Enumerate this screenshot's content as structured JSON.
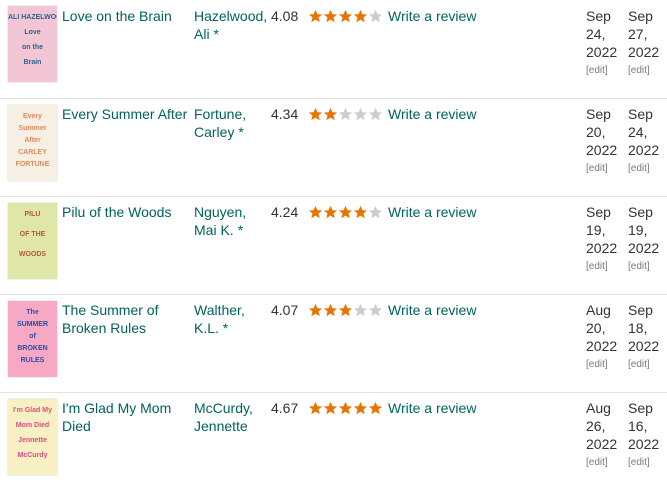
{
  "colors": {
    "link": "#00635d",
    "star_filled": "#e87400",
    "star_empty": "#cccccc"
  },
  "books": [
    {
      "title": "Love on the Brain",
      "author": "Hazelwood, Ali *",
      "avg_rating": "4.08",
      "stars": 4,
      "review_label": "Write a review",
      "date_a": [
        "Sep",
        "24,",
        "2022"
      ],
      "date_b": [
        "Sep",
        "27,",
        "2022"
      ],
      "edit_a": "[edit]",
      "edit_b": "[edit]",
      "cover": {
        "bg": "#f3c6d6",
        "accent": "#2f5f8f",
        "lines": [
          "ALI HAZELWOOD",
          "Love",
          "on the",
          "Brain"
        ]
      }
    },
    {
      "title": "Every Summer After",
      "author": "Fortune, Carley *",
      "avg_rating": "4.34",
      "stars": 2,
      "review_label": "Write a review",
      "date_a": [
        "Sep",
        "20,",
        "2022"
      ],
      "date_b": [
        "Sep",
        "24,",
        "2022"
      ],
      "edit_a": "[edit]",
      "edit_b": "[edit]",
      "cover": {
        "bg": "#f6efe4",
        "accent": "#e08a5a",
        "lines": [
          "Every",
          "Summer",
          "After",
          "CARLEY",
          "FORTUNE"
        ]
      }
    },
    {
      "title": "Pilu of the Woods",
      "author": "Nguyen, Mai K. *",
      "avg_rating": "4.24",
      "stars": 4,
      "review_label": "Write a review",
      "date_a": [
        "Sep",
        "19,",
        "2022"
      ],
      "date_b": [
        "Sep",
        "19,",
        "2022"
      ],
      "edit_a": "[edit]",
      "edit_b": "[edit]",
      "cover": {
        "bg": "#dfe6a8",
        "accent": "#b45a3a",
        "lines": [
          "PILU",
          "OF THE",
          "WOODS"
        ]
      }
    },
    {
      "title": "The Summer of Broken Rules",
      "author": "Walther, K.L. *",
      "avg_rating": "4.07",
      "stars": 3,
      "review_label": "Write a review",
      "date_a": [
        "Aug",
        "20,",
        "2022"
      ],
      "date_b": [
        "Sep",
        "18,",
        "2022"
      ],
      "edit_a": "[edit]",
      "edit_b": "[edit]",
      "cover": {
        "bg": "#f6a8c4",
        "accent": "#2b4f9e",
        "lines": [
          "The",
          "SUMMER",
          "of",
          "BROKEN",
          "RULES"
        ]
      }
    },
    {
      "title": "I'm Glad My Mom Died",
      "author": "McCurdy, Jennette",
      "avg_rating": "4.67",
      "stars": 5,
      "review_label": "Write a review",
      "date_a": [
        "Aug",
        "26,",
        "2022"
      ],
      "date_b": [
        "Sep",
        "16,",
        "2022"
      ],
      "edit_a": "[edit]",
      "edit_b": "[edit]",
      "cover": {
        "bg": "#f7f0c2",
        "accent": "#e24a86",
        "lines": [
          "I'm Glad My",
          "Mom Died",
          "Jennette",
          "McCurdy"
        ]
      }
    }
  ]
}
